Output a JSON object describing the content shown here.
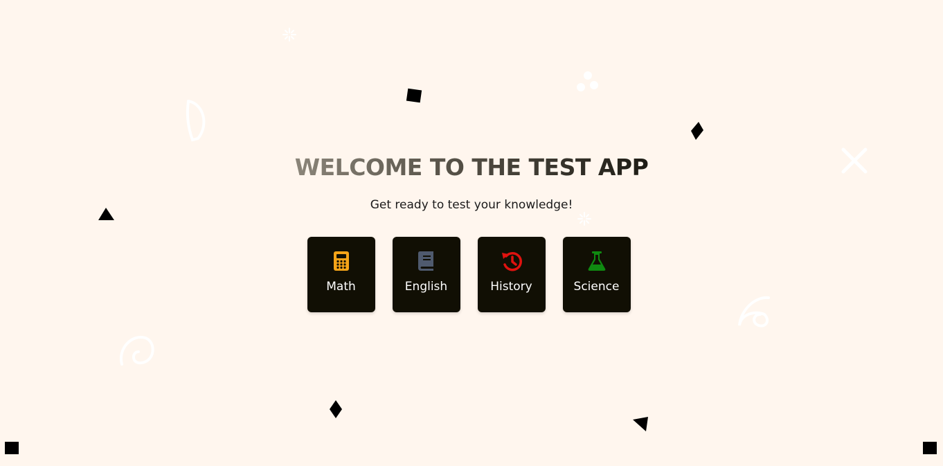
{
  "hero": {
    "title": "WELCOME TO THE TEST APP",
    "subtitle": "Get ready to test your knowledge!"
  },
  "subjects": [
    {
      "label": "Math",
      "icon": "calculator-icon",
      "color": "#f5a418"
    },
    {
      "label": "English",
      "icon": "book-icon",
      "color": "#4f5a6e"
    },
    {
      "label": "History",
      "icon": "history-icon",
      "color": "#e0120f"
    },
    {
      "label": "Science",
      "icon": "flask-icon",
      "color": "#0f8a11"
    }
  ],
  "colors": {
    "background": "#fff6ee",
    "card": "#110f04"
  }
}
